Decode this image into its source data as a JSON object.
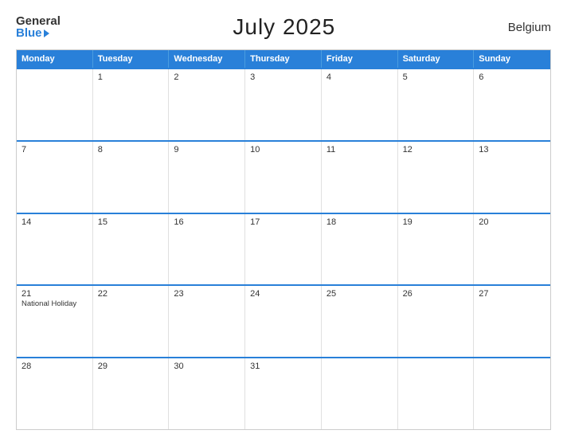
{
  "header": {
    "logo_general": "General",
    "logo_blue": "Blue",
    "title": "July 2025",
    "country": "Belgium"
  },
  "calendar": {
    "days_of_week": [
      "Monday",
      "Tuesday",
      "Wednesday",
      "Thursday",
      "Friday",
      "Saturday",
      "Sunday"
    ],
    "weeks": [
      [
        {
          "day": "",
          "event": ""
        },
        {
          "day": "1",
          "event": ""
        },
        {
          "day": "2",
          "event": ""
        },
        {
          "day": "3",
          "event": ""
        },
        {
          "day": "4",
          "event": ""
        },
        {
          "day": "5",
          "event": ""
        },
        {
          "day": "6",
          "event": ""
        }
      ],
      [
        {
          "day": "7",
          "event": ""
        },
        {
          "day": "8",
          "event": ""
        },
        {
          "day": "9",
          "event": ""
        },
        {
          "day": "10",
          "event": ""
        },
        {
          "day": "11",
          "event": ""
        },
        {
          "day": "12",
          "event": ""
        },
        {
          "day": "13",
          "event": ""
        }
      ],
      [
        {
          "day": "14",
          "event": ""
        },
        {
          "day": "15",
          "event": ""
        },
        {
          "day": "16",
          "event": ""
        },
        {
          "day": "17",
          "event": ""
        },
        {
          "day": "18",
          "event": ""
        },
        {
          "day": "19",
          "event": ""
        },
        {
          "day": "20",
          "event": ""
        }
      ],
      [
        {
          "day": "21",
          "event": "National Holiday"
        },
        {
          "day": "22",
          "event": ""
        },
        {
          "day": "23",
          "event": ""
        },
        {
          "day": "24",
          "event": ""
        },
        {
          "day": "25",
          "event": ""
        },
        {
          "day": "26",
          "event": ""
        },
        {
          "day": "27",
          "event": ""
        }
      ],
      [
        {
          "day": "28",
          "event": ""
        },
        {
          "day": "29",
          "event": ""
        },
        {
          "day": "30",
          "event": ""
        },
        {
          "day": "31",
          "event": ""
        },
        {
          "day": "",
          "event": ""
        },
        {
          "day": "",
          "event": ""
        },
        {
          "day": "",
          "event": ""
        }
      ]
    ]
  }
}
